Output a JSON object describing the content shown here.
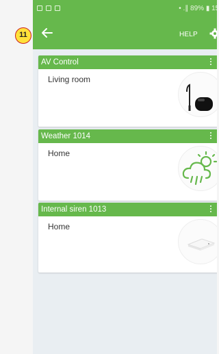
{
  "annotation": {
    "badge_number": "11"
  },
  "statusbar": {
    "right_text": "• .∥ 89% ▮ 15:"
  },
  "appbar": {
    "help_label": "HELP"
  },
  "devices": [
    {
      "title": "AV Control",
      "location": "Living room",
      "icon": "av-control-device-icon"
    },
    {
      "title": "Weather 1014",
      "location": "Home",
      "icon": "weather-cloud-sun-rain-icon"
    },
    {
      "title": "Internal siren 1013",
      "location": "Home",
      "icon": "siren-device-icon"
    }
  ],
  "colors": {
    "accent": "#66b84c",
    "background": "#e9eef2",
    "badge": "#ffe13a",
    "badge_border": "#cc1f1f"
  }
}
